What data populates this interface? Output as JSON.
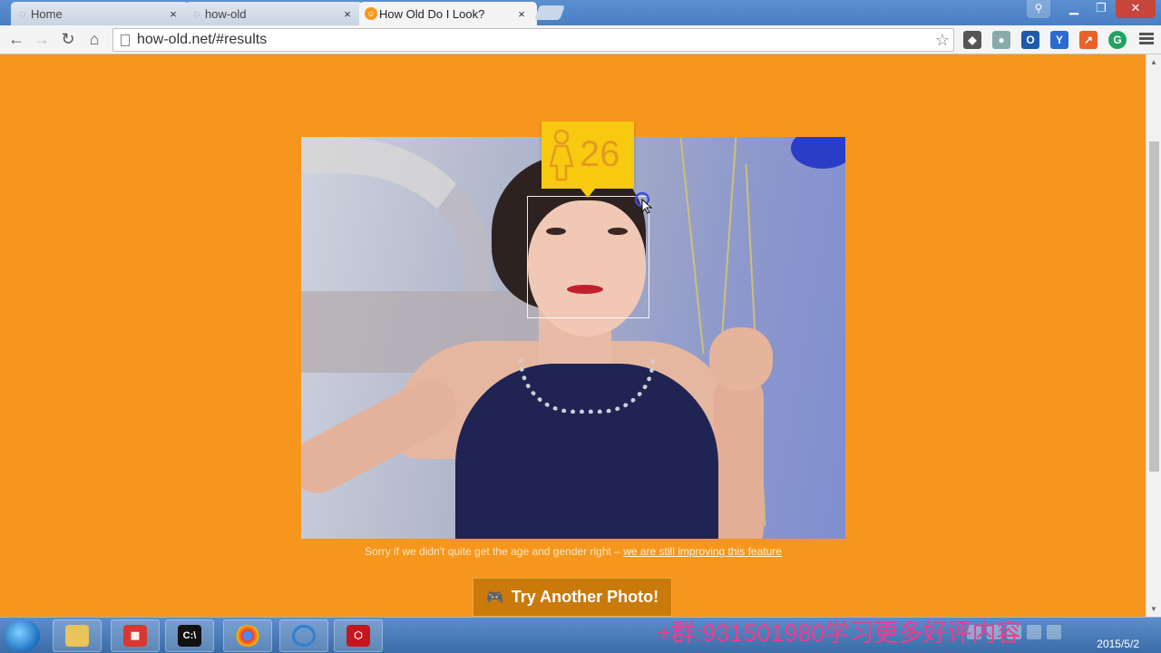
{
  "browser": {
    "tabs": [
      {
        "title": "Home",
        "active": false
      },
      {
        "title": "how-old",
        "active": false
      },
      {
        "title": "How Old Do I Look?",
        "active": true
      }
    ],
    "close_glyph": "×",
    "url": "how-old.net/#results"
  },
  "result": {
    "age": "26",
    "gender": "female"
  },
  "page": {
    "sorry_text": "Sorry if we didn't quite get the age and gender right – ",
    "sorry_link": "we are still improving this feature",
    "try_button_label": "Try Another Photo!"
  },
  "taskbar": {
    "items": [
      "file-explorer",
      "apps",
      "command-prompt",
      "chrome",
      "app-circle",
      "acrobat"
    ],
    "watermark": "+群:931501980学习更多好评内容",
    "clock_date": "2015/5/2"
  },
  "colors": {
    "page_background": "#f7961d",
    "badge": "#f8ca0f",
    "age_text": "#e29b21",
    "button": "#c97a0a"
  }
}
